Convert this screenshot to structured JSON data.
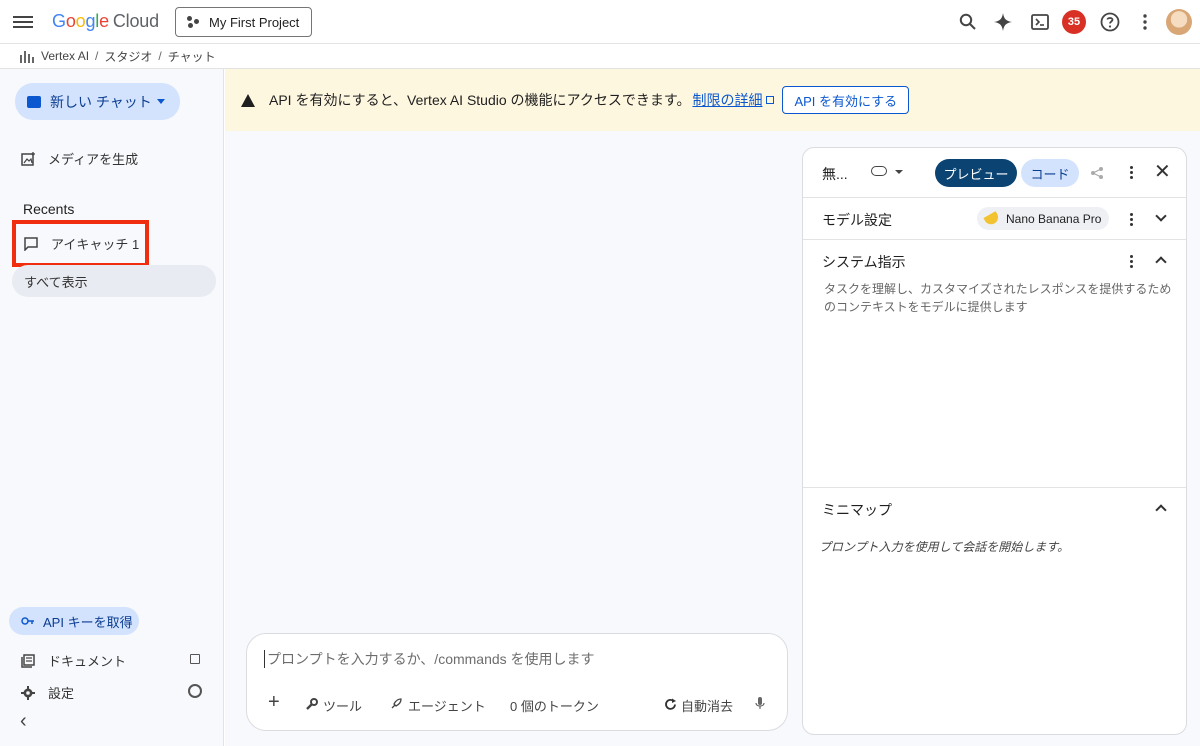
{
  "header": {
    "logo_google": "Google",
    "logo_cloud": "Cloud",
    "project_name": "My First Project",
    "notification_count": "35"
  },
  "breadcrumb": [
    "Vertex AI",
    "スタジオ",
    "チャット"
  ],
  "sidebar": {
    "new_chat_label": "新しい チャット",
    "generate_media_label": "メディアを生成",
    "recents_title": "Recents",
    "recent_items": [
      "アイキャッチ 1"
    ],
    "show_all_label": "すべて表示",
    "api_key_label": "API キーを取得",
    "docs_label": "ドキュメント",
    "settings_label": "設定"
  },
  "banner": {
    "message": "API を有効にすると、Vertex AI Studio の機能にアクセスできます。",
    "link_label": "制限の詳細",
    "enable_button_label": "API を有効にする"
  },
  "prompt": {
    "placeholder": "プロンプトを入力するか、/commands を使用します",
    "tools_label": "ツール",
    "agent_label": "エージェント",
    "token_count": "0 個のトークン",
    "auto_clear_label": "自動消去"
  },
  "panel": {
    "title": "無...",
    "preview_label": "プレビュー",
    "code_label": "コード",
    "model_settings_title": "モデル設定",
    "model_name": "Nano Banana Pro",
    "system_instructions_title": "システム指示",
    "system_instructions_placeholder": "タスクを理解し、カスタマイズされたレスポンスを提供するためのコンテキストをモデルに提供します",
    "minimap_title": "ミニマップ",
    "minimap_empty": "プロンプト入力を使用して会話を開始します。"
  },
  "colors": {
    "accent": "#0b57d0",
    "preview_button": "#0b4473",
    "badge": "#d93025",
    "highlight_box": "#f02e0f",
    "banner_bg": "#fef7e0"
  }
}
